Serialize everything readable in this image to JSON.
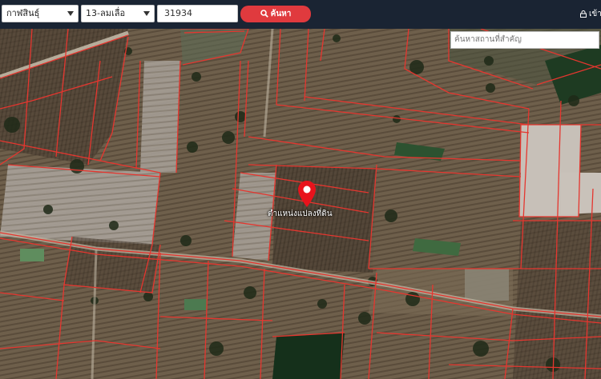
{
  "header": {
    "province_select": "กาฬสินธุ์",
    "district_select": "13-ลมเลื่อ",
    "parcel_input": "31934",
    "search_button_label": "ค้นหา",
    "login_label": "เข้าสู่ระบบ"
  },
  "map": {
    "place_search_placeholder": "ค้นหาสถานที่สำคัญ",
    "marker_label": "ตำแหน่งแปลงที่ดิน",
    "marker_color": "#e8131c",
    "parcel_line_color": "#e5362f"
  },
  "colors": {
    "header_bg": "#1a2433",
    "button_red": "#e03a3e"
  }
}
